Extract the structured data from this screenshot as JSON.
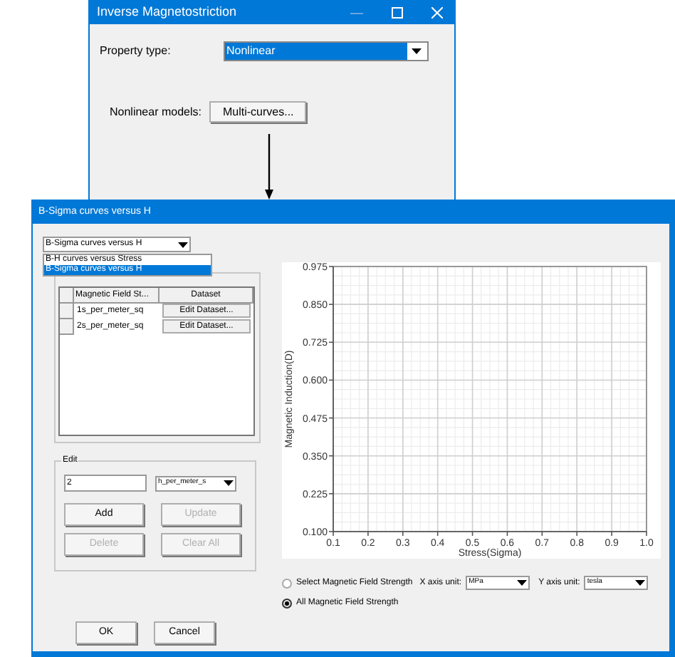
{
  "window_1": {
    "title": "Inverse Magnetostriction",
    "property_type_label": "Property type:",
    "property_type_value": "Nonlinear",
    "nonlinear_models_label": "Nonlinear models:",
    "multi_curves_button": "Multi-curves..."
  },
  "window_2": {
    "title": "B-Sigma curves versus H",
    "curve_type_value": "B-Sigma curves versus H",
    "curve_type_options": [
      {
        "label": "B-H curves versus Stress",
        "selected": false
      },
      {
        "label": "B-Sigma curves versus H",
        "selected": true
      }
    ],
    "table": {
      "columns": [
        "Magnetic Field St...",
        "Dataset"
      ],
      "rows": [
        {
          "field": "1s_per_meter_sq",
          "action": "Edit Dataset..."
        },
        {
          "field": "2s_per_meter_sq",
          "action": "Edit Dataset..."
        }
      ]
    },
    "edit": {
      "title": "Edit",
      "value": "2",
      "unit_value": "h_per_meter_s",
      "buttons": [
        {
          "label": "Add",
          "disabled": false
        },
        {
          "label": "Update",
          "disabled": true
        },
        {
          "label": "Delete",
          "disabled": true
        },
        {
          "label": "Clear All",
          "disabled": true
        }
      ]
    },
    "chart_data": {
      "type": "line",
      "grid": true,
      "xlabel": "Stress(Sigma)",
      "ylabel": "Magnetic Induction(D)",
      "xlim": [
        0.1,
        1.0
      ],
      "ylim": [
        0.1,
        0.975
      ],
      "xticks": [
        {
          "value": 0.1,
          "label": "0.1"
        },
        {
          "value": 0.2,
          "label": "0.2"
        },
        {
          "value": 0.3,
          "label": "0.3"
        },
        {
          "value": 0.4,
          "label": "0.4"
        },
        {
          "value": 0.5,
          "label": "0.5"
        },
        {
          "value": 0.6,
          "label": "0.6"
        },
        {
          "value": 0.7,
          "label": "0.7"
        },
        {
          "value": 0.8,
          "label": "0.8"
        },
        {
          "value": 0.9,
          "label": "0.9"
        },
        {
          "value": 1.0,
          "label": "1.0"
        }
      ],
      "yticks": [
        {
          "value": 0.1,
          "label": "0.100"
        },
        {
          "value": 0.225,
          "label": "0.225"
        },
        {
          "value": 0.35,
          "label": "0.350"
        },
        {
          "value": 0.475,
          "label": "0.475"
        },
        {
          "value": 0.6,
          "label": "0.600"
        },
        {
          "value": 0.725,
          "label": "0.725"
        },
        {
          "value": 0.85,
          "label": "0.850"
        },
        {
          "value": 0.975,
          "label": "0.975"
        }
      ]
    },
    "options": [
      {
        "label": "Select Magnetic Field Strength",
        "selected": false
      },
      {
        "label": "All Magnetic Field Strength",
        "selected": true
      }
    ],
    "x_unit_label": "X axis unit:",
    "x_unit": "MPa",
    "y_unit_label": "Y axis unit:",
    "y_unit": "tesla",
    "buttons": [
      "OK",
      "Cancel"
    ]
  }
}
